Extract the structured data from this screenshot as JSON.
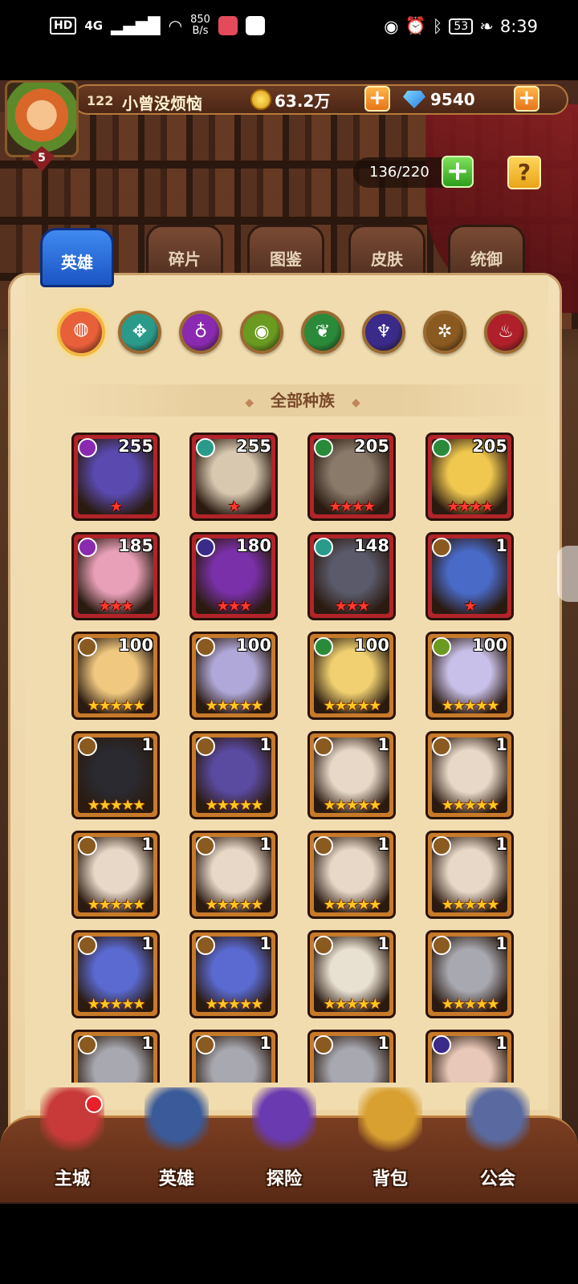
{
  "status_bar": {
    "hd": "HD",
    "network": "4G",
    "speed_top": "850",
    "speed_bottom": "B/s",
    "battery": "53",
    "time": "8:39"
  },
  "player": {
    "level": "122",
    "name": "小曾没烦恼",
    "avatar_rank": "5"
  },
  "resources": {
    "gold": "63.2万",
    "gems": "9540",
    "plus": "+"
  },
  "capacity": {
    "value": "136/220",
    "plus": "+",
    "help": "?"
  },
  "tabs": [
    "英雄",
    "碎片",
    "图鉴",
    "皮肤",
    "统御"
  ],
  "active_tab": 0,
  "factions": [
    {
      "name": "all-factions-icon",
      "color": "#e8603a",
      "glyph": "◍"
    },
    {
      "name": "forest-faction-icon",
      "color": "#2a9a8a",
      "glyph": "✥"
    },
    {
      "name": "shadow-faction-icon",
      "color": "#8a2ab0",
      "glyph": "♁"
    },
    {
      "name": "nature-faction-icon",
      "color": "#6a9a20",
      "glyph": "◉"
    },
    {
      "name": "leaf-faction-icon",
      "color": "#2a8a3a",
      "glyph": "❦"
    },
    {
      "name": "demon-faction-icon",
      "color": "#3a2a8a",
      "glyph": "♆"
    },
    {
      "name": "light-faction-icon",
      "color": "#8a5a20",
      "glyph": "✲"
    },
    {
      "name": "fire-faction-icon",
      "color": "#b0202a",
      "glyph": "♨"
    }
  ],
  "race_title": "全部种族",
  "heroes": [
    {
      "level": "255",
      "stars": "★",
      "frame": "red",
      "faction": "#8a2ab0",
      "tone": "#5a4ab0"
    },
    {
      "level": "255",
      "stars": "★",
      "frame": "red",
      "faction": "#2a9a8a",
      "tone": "#d8c8b0"
    },
    {
      "level": "205",
      "stars": "★★★★",
      "frame": "red",
      "faction": "#2a8a3a",
      "tone": "#8a7a6a"
    },
    {
      "level": "205",
      "stars": "★★★★",
      "frame": "red",
      "faction": "#2a8a3a",
      "tone": "#f0c850"
    },
    {
      "level": "185",
      "stars": "★★★",
      "frame": "red",
      "faction": "#8a2ab0",
      "tone": "#e8a0b8"
    },
    {
      "level": "180",
      "stars": "★★★",
      "frame": "red",
      "faction": "#3a2a8a",
      "tone": "#7a30a8"
    },
    {
      "level": "148",
      "stars": "★★★",
      "frame": "red",
      "faction": "#2a9a8a",
      "tone": "#5a5a6a"
    },
    {
      "level": "1",
      "stars": "★",
      "frame": "red",
      "faction": "#8a5a20",
      "tone": "#4a6ac8"
    },
    {
      "level": "100",
      "stars": "★★★★★",
      "frame": "gold",
      "faction": "#8a5a20",
      "tone": "#f0c880"
    },
    {
      "level": "100",
      "stars": "★★★★★",
      "frame": "gold",
      "faction": "#8a5a20",
      "tone": "#b0a8d8"
    },
    {
      "level": "100",
      "stars": "★★★★★",
      "frame": "gold",
      "faction": "#2a8a3a",
      "tone": "#f0d070"
    },
    {
      "level": "100",
      "stars": "★★★★★",
      "frame": "gold",
      "faction": "#6a9a20",
      "tone": "#c8c0e8"
    },
    {
      "level": "1",
      "stars": "★★★★★",
      "frame": "gold",
      "faction": "#8a5a20",
      "tone": "#2a2a30"
    },
    {
      "level": "1",
      "stars": "★★★★★",
      "frame": "gold",
      "faction": "#8a5a20",
      "tone": "#5a4aa0"
    },
    {
      "level": "1",
      "stars": "★★★★★",
      "frame": "gold",
      "faction": "#8a5a20",
      "tone": "#e8d8c8"
    },
    {
      "level": "1",
      "stars": "★★★★★",
      "frame": "gold",
      "faction": "#8a5a20",
      "tone": "#e8d8c8"
    },
    {
      "level": "1",
      "stars": "★★★★★",
      "frame": "gold",
      "faction": "#8a5a20",
      "tone": "#e8d8c8"
    },
    {
      "level": "1",
      "stars": "★★★★★",
      "frame": "gold",
      "faction": "#8a5a20",
      "tone": "#e8d8c8"
    },
    {
      "level": "1",
      "stars": "★★★★★",
      "frame": "gold",
      "faction": "#8a5a20",
      "tone": "#e8d8c8"
    },
    {
      "level": "1",
      "stars": "★★★★★",
      "frame": "gold",
      "faction": "#8a5a20",
      "tone": "#e8d8c8"
    },
    {
      "level": "1",
      "stars": "★★★★★",
      "frame": "gold",
      "faction": "#8a5a20",
      "tone": "#5a6ad0"
    },
    {
      "level": "1",
      "stars": "★★★★★",
      "frame": "gold",
      "faction": "#8a5a20",
      "tone": "#5a6ad0"
    },
    {
      "level": "1",
      "stars": "★★★★★",
      "frame": "gold",
      "faction": "#8a5a20",
      "tone": "#e8e0d0"
    },
    {
      "level": "1",
      "stars": "★★★★★",
      "frame": "gold",
      "faction": "#8a5a20",
      "tone": "#a8a8b0"
    },
    {
      "level": "1",
      "stars": "",
      "frame": "gold",
      "faction": "#8a5a20",
      "tone": "#a8a8b0"
    },
    {
      "level": "1",
      "stars": "",
      "frame": "gold",
      "faction": "#8a5a20",
      "tone": "#a8a8b0"
    },
    {
      "level": "1",
      "stars": "",
      "frame": "gold",
      "faction": "#8a5a20",
      "tone": "#a8a8b0"
    },
    {
      "level": "1",
      "stars": "",
      "frame": "gold",
      "faction": "#3a2a8a",
      "tone": "#e8c8b8"
    }
  ],
  "bottom_nav": [
    {
      "label": "主城",
      "name": "nav-main-city",
      "color": "#c83a3a"
    },
    {
      "label": "英雄",
      "name": "nav-heroes",
      "color": "#3a5a9a"
    },
    {
      "label": "探险",
      "name": "nav-explore",
      "color": "#6a3ab0"
    },
    {
      "label": "背包",
      "name": "nav-backpack",
      "color": "#d8a030"
    },
    {
      "label": "公会",
      "name": "nav-guild",
      "color": "#5a6aa0"
    }
  ]
}
